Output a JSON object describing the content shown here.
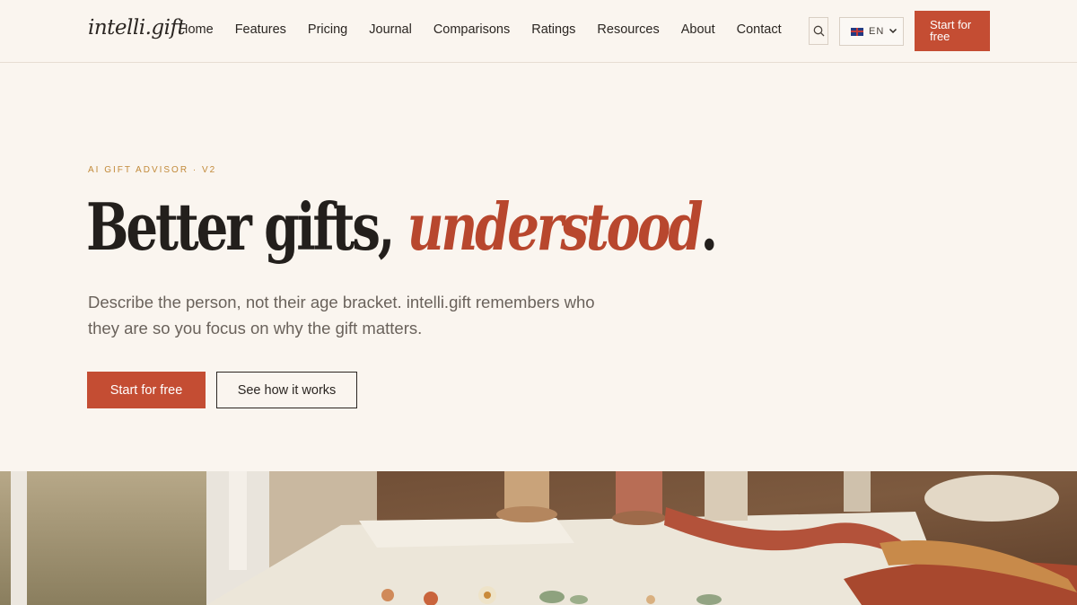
{
  "brand": {
    "logo_text": "intelli.gift"
  },
  "nav": {
    "links": [
      "Home",
      "Features",
      "Pricing",
      "Journal",
      "Comparisons",
      "Ratings",
      "Resources",
      "About",
      "Contact"
    ],
    "language": "EN",
    "cta_label": "Start for free"
  },
  "hero": {
    "eyebrow": "AI GIFT ADVISOR · V2",
    "headline_main": "Better gifts, ",
    "headline_accent": "understood",
    "headline_end": ".",
    "subhead": "Describe the person, not their age bracket. intelli.gift remembers who they are so you focus on why the gift matters.",
    "primary_button": "Start for free",
    "secondary_button": "See how it works"
  },
  "colors": {
    "background": "#faf5ef",
    "accent": "#c44d33",
    "eyebrow": "#c28a3a",
    "text": "#2b2622"
  },
  "icons": {
    "search": "search-icon",
    "language_flag": "uk-flag-icon",
    "dropdown": "chevron-down-icon"
  }
}
